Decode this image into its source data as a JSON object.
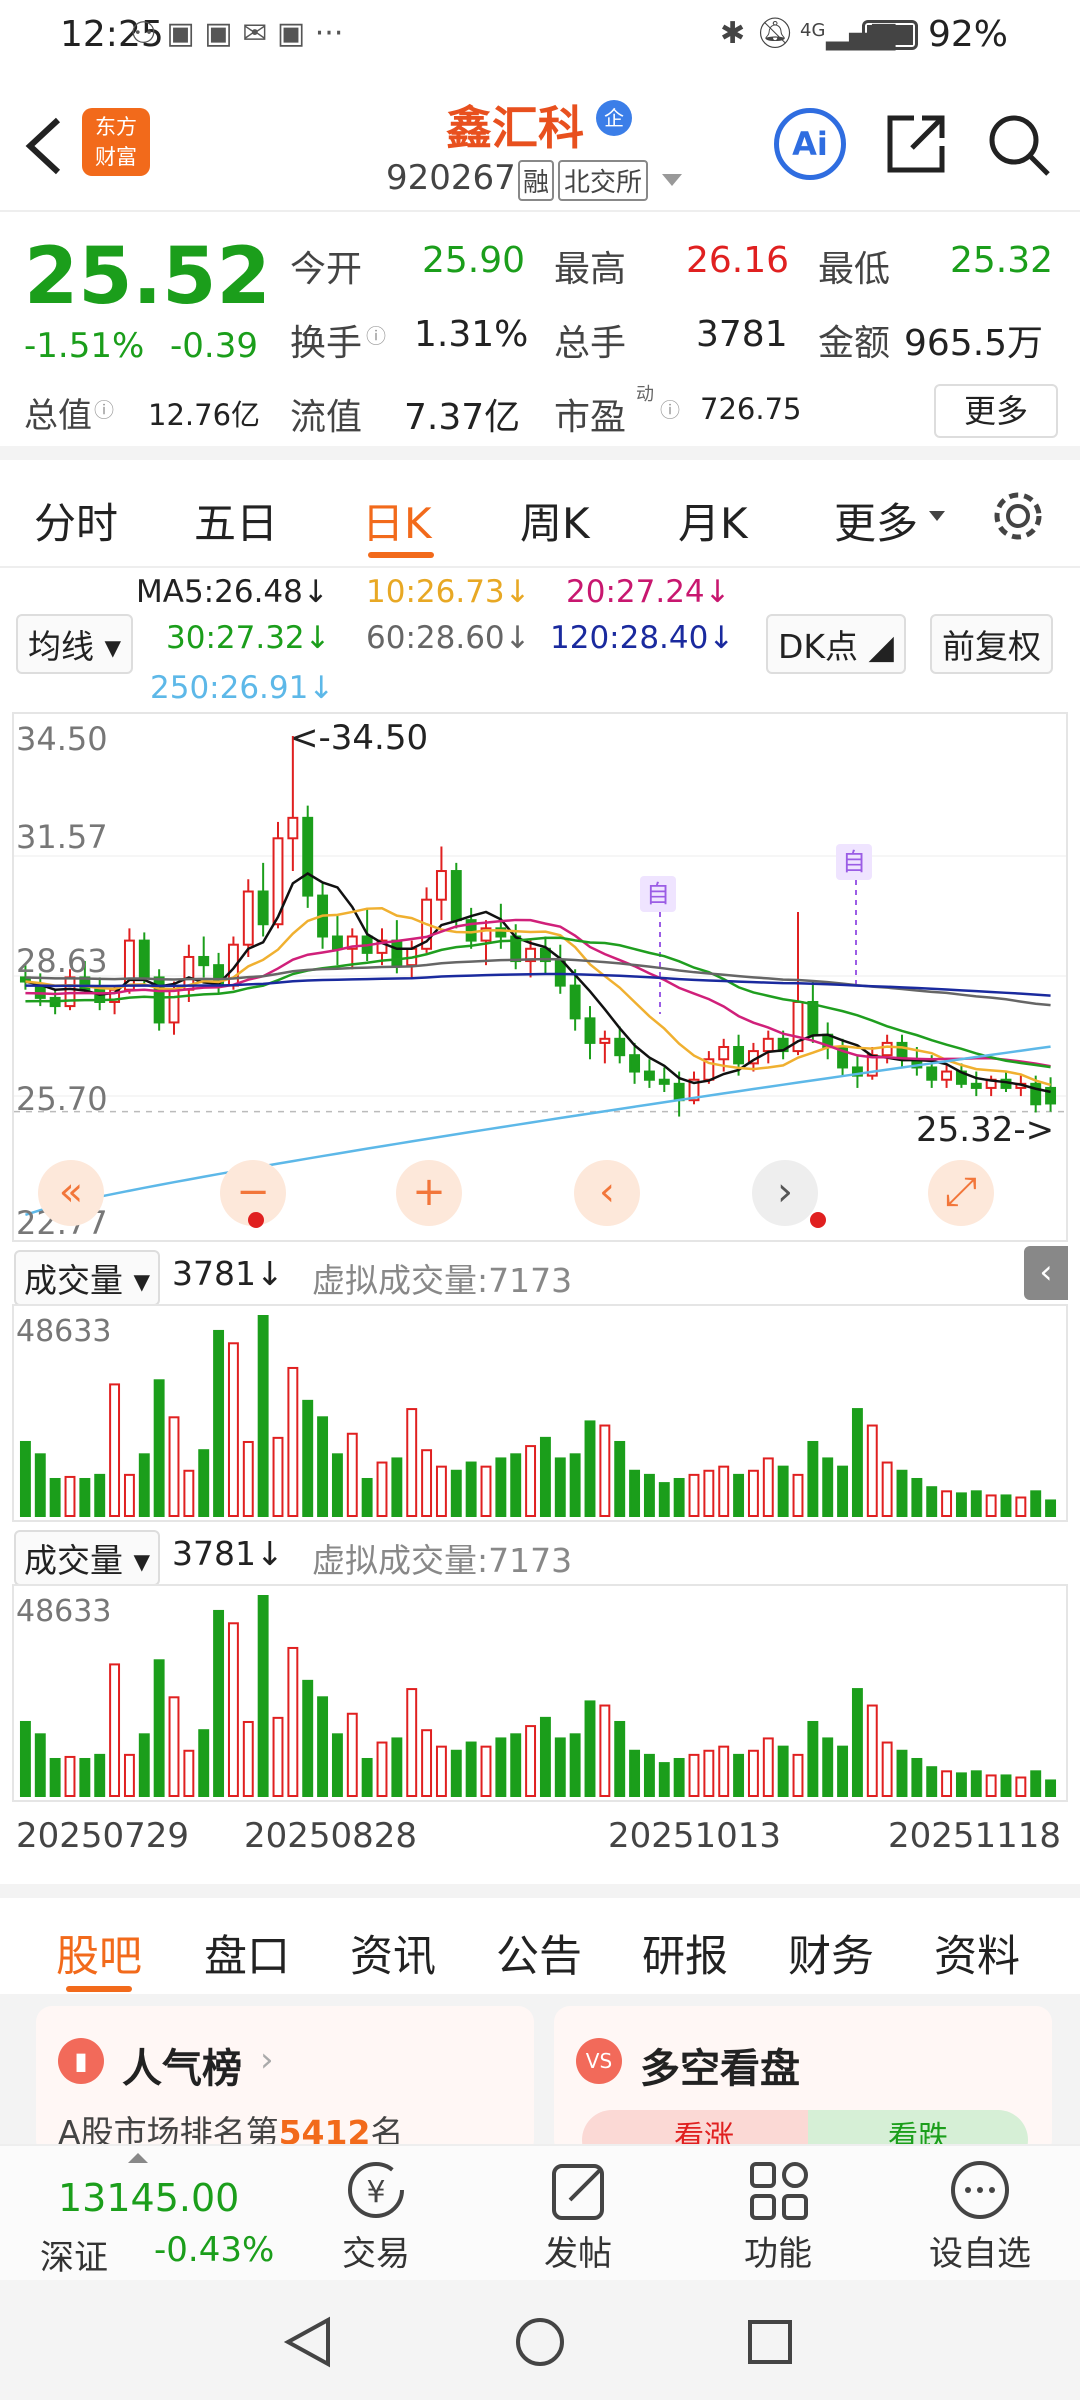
{
  "status": {
    "time": "12:25",
    "network": "4G",
    "battery": "92%"
  },
  "header": {
    "app_logo_line1": "东方",
    "app_logo_line2": "财富",
    "stock_name": "鑫汇科",
    "code": "920267",
    "margin_tag": "融",
    "exchange": "北交所",
    "ai_label": "Ai"
  },
  "quote": {
    "price": "25.52",
    "change_pct": "-1.51%",
    "change": "-0.39",
    "open_label": "今开",
    "open": "25.90",
    "high_label": "最高",
    "high": "26.16",
    "low_label": "最低",
    "low": "25.32",
    "turnover_label": "换手",
    "turnover": "1.31%",
    "volume_label": "总手",
    "volume": "3781",
    "amount_label": "金额",
    "amount": "965.5万",
    "mcap_label": "总值",
    "mcap": "12.76亿",
    "float_label": "流值",
    "float": "7.37亿",
    "pe_label": "市盈",
    "pe_sup": "动",
    "pe": "726.75",
    "more": "更多"
  },
  "kline_tabs": [
    "分时",
    "五日",
    "日K",
    "周K",
    "月K",
    "更多"
  ],
  "active_tab": "日K",
  "ma": {
    "selector": "均线",
    "ma5": "MA5:26.48↓",
    "ma10": "10:26.73↓",
    "ma20": "20:27.24↓",
    "ma30": "30:27.32↓",
    "ma60": "60:28.60↓",
    "ma120": "120:28.40↓",
    "ma250": "250:26.91↓",
    "dk": "DK点",
    "fq": "前复权"
  },
  "colors": {
    "up": "#e02020",
    "down": "#1b9e1b",
    "ma5": "#111111",
    "ma10": "#f0b030",
    "ma20": "#d0207a",
    "ma30": "#1f9e1f",
    "ma60": "#666666",
    "ma120": "#1a2a9e",
    "ma250": "#5db8e8",
    "accent": "#f26a1b"
  },
  "price_chart": {
    "y_labels": [
      "34.50",
      "31.57",
      "28.63",
      "25.70",
      "22.77"
    ],
    "max_label": "<-34.50",
    "min_label": "25.32->",
    "markers": [
      "自",
      "自"
    ]
  },
  "volume_panels": [
    {
      "selector": "成交量",
      "value": "3781↓",
      "virtual": "虚拟成交量:7173",
      "max": "48633"
    },
    {
      "selector": "成交量",
      "value": "3781↓",
      "virtual": "虚拟成交量:7173",
      "max": "48633"
    }
  ],
  "dates": [
    "20250729",
    "20250828",
    "20251013",
    "20251118"
  ],
  "bottom_tabs": [
    "股吧",
    "盘口",
    "资讯",
    "公告",
    "研报",
    "财务",
    "资料"
  ],
  "cards": {
    "popular_title": "人气榜",
    "popular_text_pre": "A股市场排名第",
    "popular_rank": "5412",
    "popular_text_post": "名",
    "vs_title": "多空看盘",
    "bull": "看涨",
    "bear": "看跌"
  },
  "footer": {
    "index_value": "13145.00",
    "index_name": "深证",
    "index_change": "-0.43%",
    "trade": "交易",
    "post": "发帖",
    "func": "功能",
    "watch": "设自选"
  },
  "chart_data": {
    "type": "candlestick",
    "ylim": [
      22.77,
      34.5
    ],
    "candles_ohlc": [
      [
        28.6,
        28.9,
        28.3,
        28.5
      ],
      [
        28.4,
        28.7,
        27.9,
        28.1
      ],
      [
        28.1,
        28.3,
        27.7,
        27.9
      ],
      [
        27.9,
        28.8,
        27.8,
        28.6
      ],
      [
        28.6,
        29.0,
        28.2,
        28.3
      ],
      [
        28.3,
        28.6,
        27.8,
        28.0
      ],
      [
        28.0,
        28.4,
        27.7,
        28.3
      ],
      [
        28.3,
        29.8,
        28.2,
        29.5
      ],
      [
        29.5,
        29.7,
        28.4,
        28.6
      ],
      [
        28.6,
        28.8,
        27.3,
        27.5
      ],
      [
        27.5,
        28.5,
        27.2,
        28.3
      ],
      [
        28.3,
        29.4,
        28.0,
        29.1
      ],
      [
        29.1,
        29.6,
        28.6,
        28.9
      ],
      [
        28.9,
        29.2,
        28.2,
        28.4
      ],
      [
        28.4,
        29.6,
        28.3,
        29.4
      ],
      [
        29.4,
        31.0,
        29.1,
        30.7
      ],
      [
        30.7,
        31.4,
        29.6,
        29.9
      ],
      [
        29.9,
        32.4,
        29.8,
        32.0
      ],
      [
        32.0,
        34.5,
        31.2,
        32.5
      ],
      [
        32.5,
        32.8,
        30.3,
        30.6
      ],
      [
        30.6,
        30.9,
        29.3,
        29.6
      ],
      [
        29.6,
        30.1,
        28.9,
        29.3
      ],
      [
        29.3,
        29.8,
        28.8,
        29.6
      ],
      [
        29.6,
        30.3,
        29.0,
        29.2
      ],
      [
        29.2,
        29.8,
        28.9,
        29.5
      ],
      [
        29.5,
        30.0,
        28.7,
        28.9
      ],
      [
        28.9,
        29.5,
        28.6,
        29.3
      ],
      [
        29.3,
        30.8,
        29.2,
        30.5
      ],
      [
        30.5,
        31.8,
        30.0,
        31.2
      ],
      [
        31.2,
        31.4,
        29.8,
        30.0
      ],
      [
        30.0,
        30.3,
        29.3,
        29.5
      ],
      [
        29.5,
        30.0,
        28.9,
        29.8
      ],
      [
        29.8,
        30.4,
        29.3,
        29.6
      ],
      [
        29.6,
        29.9,
        28.8,
        29.0
      ],
      [
        29.0,
        29.5,
        28.6,
        29.3
      ],
      [
        29.3,
        29.6,
        28.7,
        29.0
      ],
      [
        29.0,
        29.4,
        28.2,
        28.4
      ],
      [
        28.4,
        28.8,
        27.3,
        27.6
      ],
      [
        27.6,
        27.9,
        26.6,
        27.0
      ],
      [
        27.0,
        27.3,
        26.5,
        27.1
      ],
      [
        27.1,
        27.4,
        26.5,
        26.7
      ],
      [
        26.7,
        27.0,
        26.0,
        26.3
      ],
      [
        26.3,
        26.6,
        25.9,
        26.1
      ],
      [
        26.1,
        26.4,
        25.8,
        26.0
      ],
      [
        26.0,
        26.3,
        25.2,
        25.6
      ],
      [
        25.6,
        26.3,
        25.5,
        26.1
      ],
      [
        26.1,
        26.8,
        26.0,
        26.6
      ],
      [
        26.6,
        27.1,
        26.3,
        26.9
      ],
      [
        26.9,
        27.2,
        26.2,
        26.5
      ],
      [
        26.5,
        27.0,
        26.3,
        26.8
      ],
      [
        26.8,
        27.3,
        26.5,
        27.1
      ],
      [
        27.1,
        27.3,
        26.6,
        26.8
      ],
      [
        26.8,
        30.2,
        26.7,
        28.0
      ],
      [
        28.0,
        28.5,
        27.0,
        27.2
      ],
      [
        27.2,
        27.5,
        26.6,
        26.9
      ],
      [
        26.9,
        27.1,
        26.2,
        26.4
      ],
      [
        26.4,
        26.7,
        25.9,
        26.2
      ],
      [
        26.2,
        26.9,
        26.1,
        26.7
      ],
      [
        26.7,
        27.2,
        26.5,
        27.0
      ],
      [
        27.0,
        27.2,
        26.4,
        26.6
      ],
      [
        26.6,
        26.9,
        26.2,
        26.4
      ],
      [
        26.4,
        26.7,
        25.9,
        26.1
      ],
      [
        26.1,
        26.5,
        25.9,
        26.3
      ],
      [
        26.3,
        26.5,
        25.9,
        26.0
      ],
      [
        26.0,
        26.3,
        25.7,
        25.9
      ],
      [
        25.9,
        26.2,
        25.7,
        26.1
      ],
      [
        26.1,
        26.3,
        25.8,
        25.9
      ],
      [
        25.9,
        26.2,
        25.7,
        26.0
      ],
      [
        26.0,
        26.2,
        25.3,
        25.5
      ],
      [
        25.9,
        26.16,
        25.32,
        25.52
      ]
    ],
    "volumes": [
      18000,
      15000,
      9000,
      9500,
      9000,
      10000,
      32000,
      10000,
      15000,
      33000,
      24000,
      11000,
      16000,
      45000,
      42000,
      18000,
      48633,
      19000,
      36000,
      28000,
      24000,
      15000,
      20000,
      9000,
      13000,
      14000,
      26000,
      16000,
      12000,
      11000,
      13000,
      12000,
      14000,
      15000,
      17000,
      19000,
      14000,
      15000,
      23000,
      22000,
      18000,
      11000,
      10000,
      8000,
      9000,
      10000,
      11000,
      12000,
      10000,
      11000,
      14000,
      12000,
      10000,
      18000,
      14000,
      12000,
      26000,
      22000,
      13000,
      11000,
      9000,
      7000,
      6000,
      5500,
      6000,
      5000,
      5000,
      4500,
      6000,
      3781
    ]
  }
}
